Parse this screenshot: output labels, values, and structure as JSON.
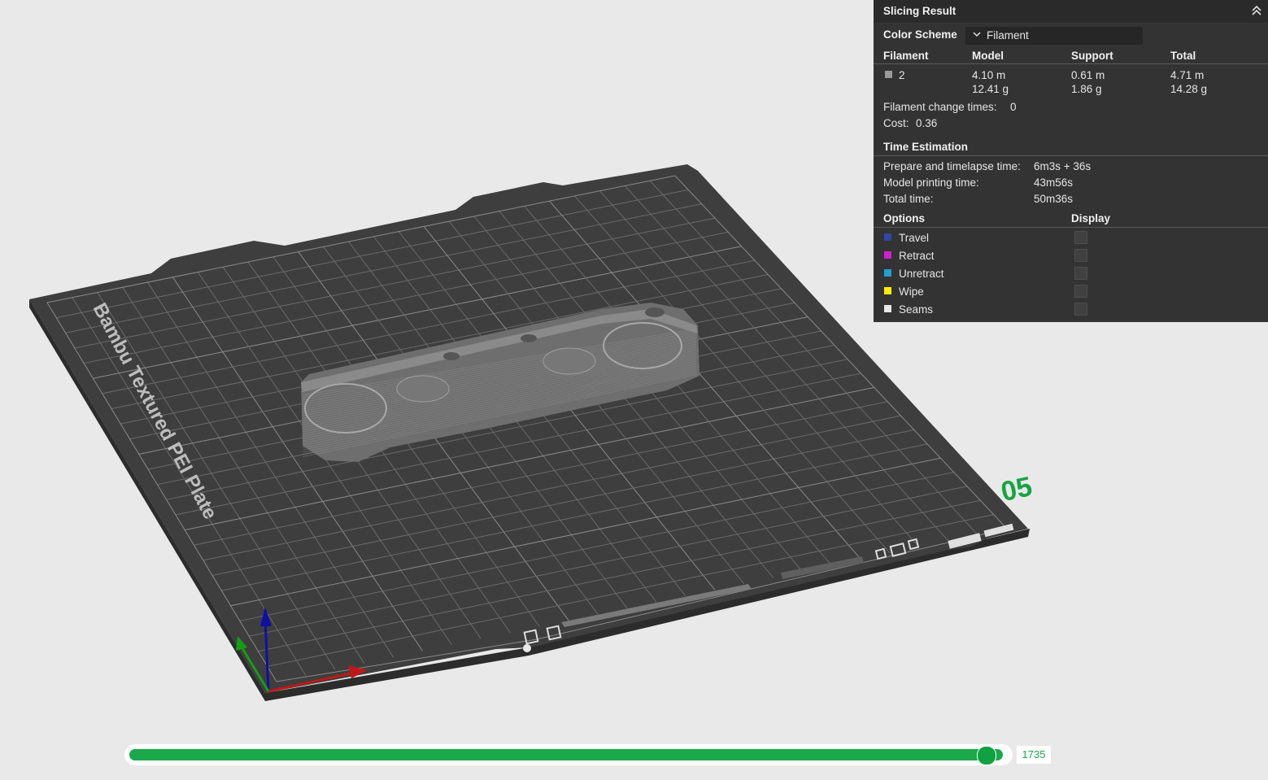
{
  "panel": {
    "title": "Slicing Result",
    "color_scheme_label": "Color Scheme",
    "color_scheme_value": "Filament",
    "table_headers": [
      "Filament",
      "Model",
      "Support",
      "Total"
    ],
    "filament_row": {
      "id": "2",
      "swatch_color": "#9a9a9a",
      "model_length": "4.10 m",
      "model_weight": "12.41 g",
      "support_length": "0.61 m",
      "support_weight": "1.86 g",
      "total_length": "4.71 m",
      "total_weight": "14.28 g"
    },
    "filament_change_label": "Filament change times:",
    "filament_change_value": "0",
    "cost_label": "Cost:",
    "cost_value": "0.36",
    "time_header": "Time Estimation",
    "prepare_label": "Prepare and timelapse time:",
    "prepare_value": "6m3s + 36s",
    "model_time_label": "Model printing time:",
    "model_time_value": "43m56s",
    "total_time_label": "Total time:",
    "total_time_value": "50m36s",
    "options_header": "Options",
    "display_header": "Display",
    "options": [
      {
        "label": "Travel",
        "color": "#3344aa"
      },
      {
        "label": "Retract",
        "color": "#d020d0"
      },
      {
        "label": "Unretract",
        "color": "#20a0d0"
      },
      {
        "label": "Wipe",
        "color": "#ffee00"
      },
      {
        "label": "Seams",
        "color": "#e8e8e8"
      }
    ]
  },
  "plate": {
    "label": "Bambu Textured PEI Plate",
    "number": "05"
  },
  "slider": {
    "value": "1735",
    "fraction": 0.98
  },
  "colors": {
    "accent": "#1ba84a",
    "plate": "#3e3e3e",
    "panel_bg": "#333333"
  }
}
